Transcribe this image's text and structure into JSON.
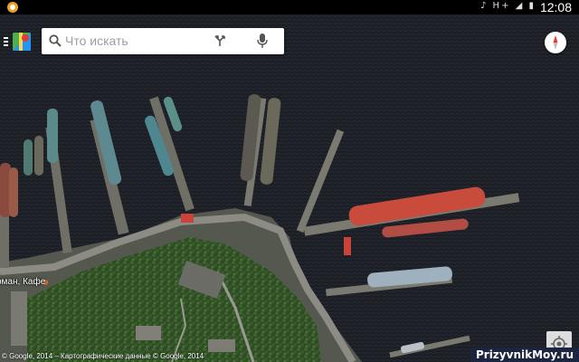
{
  "status_bar": {
    "time": "12:08",
    "icons_text": "♪ H+ ◢ ▮"
  },
  "search": {
    "placeholder": "Что искать"
  },
  "map": {
    "place_label": "рман, Кафе",
    "copyright": "© Google, 2014 – Картографические данные © Google, 2014"
  },
  "watermark": "PrizyvnikMoy.ru",
  "icons": {
    "app_notification": "maps-notification-icon",
    "search": "search-icon",
    "directions": "directions-icon",
    "mic": "mic-icon",
    "menu": "menu-icon",
    "logo": "google-maps-logo-icon",
    "compass": "compass-icon",
    "location": "my-location-icon"
  },
  "colors": {
    "water": "#1b1e24",
    "land": "#3d4a34",
    "pier": "#6f6f66",
    "ship_red": "#c84b3c",
    "status_bar": "#000000"
  }
}
